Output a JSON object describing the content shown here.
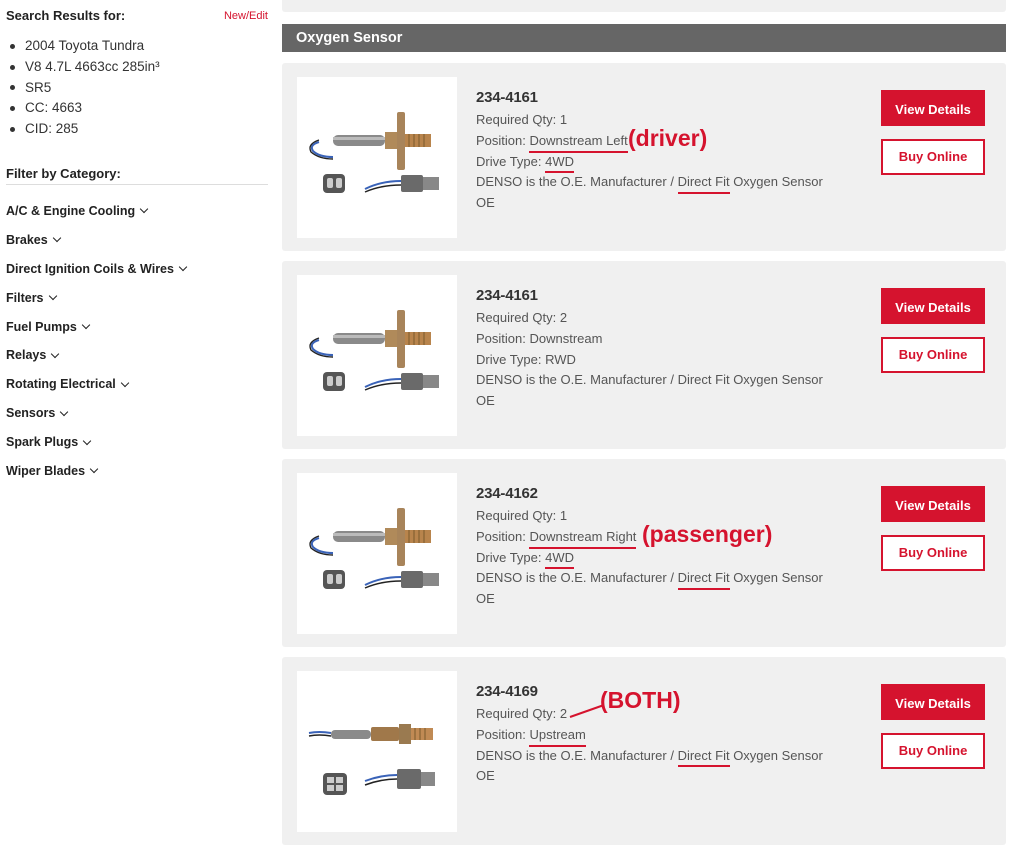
{
  "sidebar": {
    "search_title": "Search Results for:",
    "edit_link": "New/Edit",
    "vehicle": [
      "2004 Toyota Tundra",
      "V8 4.7L 4663cc 285in³",
      "SR5",
      "CC: 4663",
      "CID: 285"
    ],
    "filter_title": "Filter by Category:",
    "categories": [
      "A/C & Engine Cooling",
      "Brakes",
      "Direct Ignition Coils & Wires",
      "Filters",
      "Fuel Pumps",
      "Relays",
      "Rotating Electrical",
      "Sensors",
      "Spark Plugs",
      "Wiper Blades"
    ]
  },
  "main": {
    "section_title": "Oxygen Sensor",
    "buttons": {
      "view": "View Details",
      "buy": "Buy Online"
    },
    "products": [
      {
        "part": "234-4161",
        "qty": "Required Qty: 1",
        "pos_prefix": "Position: ",
        "pos_value": "Downstream Left",
        "drive_prefix": "Drive Type: ",
        "drive_value": "4WD",
        "desc_a": "DENSO is the O.E. Manufacturer / ",
        "desc_b": "Direct Fit",
        "desc_c": " Oxygen Sensor",
        "oe": "OE",
        "annotation": "(driver)"
      },
      {
        "part": "234-4161",
        "qty": "Required Qty: 2",
        "pos_prefix": "Position: ",
        "pos_value": "Downstream",
        "drive_prefix": "Drive Type: ",
        "drive_value": "RWD",
        "desc_a": "DENSO is the O.E. Manufacturer / ",
        "desc_b": "Direct Fit",
        "desc_c": " Oxygen Sensor",
        "oe": "OE"
      },
      {
        "part": "234-4162",
        "qty": "Required Qty: 1",
        "pos_prefix": "Position: ",
        "pos_value": "Downstream Right",
        "drive_prefix": "Drive Type: ",
        "drive_value": "4WD",
        "desc_a": "DENSO is the O.E. Manufacturer / ",
        "desc_b": "Direct Fit",
        "desc_c": " Oxygen Sensor",
        "oe": "OE",
        "annotation": "(passenger)"
      },
      {
        "part": "234-4169",
        "qty": "Required Qty: 2",
        "pos_prefix": "Position: ",
        "pos_value": "Upstream",
        "desc_a": "DENSO is the O.E. Manufacturer / ",
        "desc_b": "Direct Fit",
        "desc_c": " Oxygen Sensor",
        "oe": "OE",
        "annotation": "(BOTH)"
      }
    ]
  },
  "colors": {
    "brand_red": "#d5132e",
    "section_bar": "#666666",
    "card_bg": "#f0f0f0"
  },
  "icons": {
    "category_toggle": "chevron-down-icon",
    "product_image": "oxygen-sensor-image"
  }
}
